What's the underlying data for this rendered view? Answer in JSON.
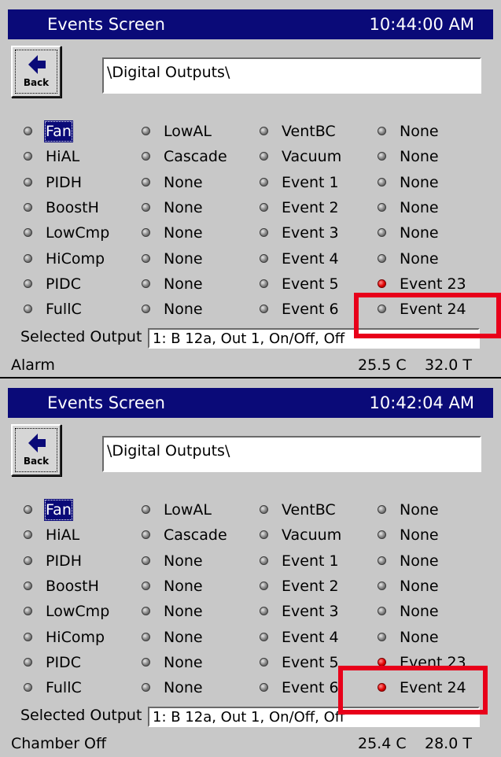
{
  "screens": [
    {
      "title": "Events Screen",
      "clock": "10:44:00 AM",
      "back_label": "Back",
      "path": "\\Digital Outputs\\",
      "columns": [
        [
          {
            "label": "Fan",
            "on": false,
            "selected": true
          },
          {
            "label": "HiAL",
            "on": false
          },
          {
            "label": "PIDH",
            "on": false
          },
          {
            "label": "BoostH",
            "on": false
          },
          {
            "label": "LowCmp",
            "on": false
          },
          {
            "label": "HiComp",
            "on": false
          },
          {
            "label": "PIDC",
            "on": false
          },
          {
            "label": "FullC",
            "on": false
          }
        ],
        [
          {
            "label": "LowAL",
            "on": false
          },
          {
            "label": "Cascade",
            "on": false
          },
          {
            "label": "None",
            "on": false
          },
          {
            "label": "None",
            "on": false
          },
          {
            "label": "None",
            "on": false
          },
          {
            "label": "None",
            "on": false
          },
          {
            "label": "None",
            "on": false
          },
          {
            "label": "None",
            "on": false
          }
        ],
        [
          {
            "label": "VentBC",
            "on": false
          },
          {
            "label": "Vacuum",
            "on": false
          },
          {
            "label": "Event 1",
            "on": false
          },
          {
            "label": "Event 2",
            "on": false
          },
          {
            "label": "Event 3",
            "on": false
          },
          {
            "label": "Event 4",
            "on": false
          },
          {
            "label": "Event 5",
            "on": false
          },
          {
            "label": "Event 6",
            "on": false
          }
        ],
        [
          {
            "label": "None",
            "on": false
          },
          {
            "label": "None",
            "on": false
          },
          {
            "label": "None",
            "on": false
          },
          {
            "label": "None",
            "on": false
          },
          {
            "label": "None",
            "on": false
          },
          {
            "label": "None",
            "on": false
          },
          {
            "label": "Event 23",
            "on": true
          },
          {
            "label": "Event 24",
            "on": false
          }
        ]
      ],
      "selected_output_label": "Selected Output",
      "selected_output_value": "1: B 12a, Out 1, On/Off, Off",
      "status": "Alarm",
      "temp_actual": "25.5 C",
      "temp_target": "32.0 T"
    },
    {
      "title": "Events Screen",
      "clock": "10:42:04 AM",
      "back_label": "Back",
      "path": "\\Digital Outputs\\",
      "columns": [
        [
          {
            "label": "Fan",
            "on": false,
            "selected": true
          },
          {
            "label": "HiAL",
            "on": false
          },
          {
            "label": "PIDH",
            "on": false
          },
          {
            "label": "BoostH",
            "on": false
          },
          {
            "label": "LowCmp",
            "on": false
          },
          {
            "label": "HiComp",
            "on": false
          },
          {
            "label": "PIDC",
            "on": false
          },
          {
            "label": "FullC",
            "on": false
          }
        ],
        [
          {
            "label": "LowAL",
            "on": false
          },
          {
            "label": "Cascade",
            "on": false
          },
          {
            "label": "None",
            "on": false
          },
          {
            "label": "None",
            "on": false
          },
          {
            "label": "None",
            "on": false
          },
          {
            "label": "None",
            "on": false
          },
          {
            "label": "None",
            "on": false
          },
          {
            "label": "None",
            "on": false
          }
        ],
        [
          {
            "label": "VentBC",
            "on": false
          },
          {
            "label": "Vacuum",
            "on": false
          },
          {
            "label": "Event 1",
            "on": false
          },
          {
            "label": "Event 2",
            "on": false
          },
          {
            "label": "Event 3",
            "on": false
          },
          {
            "label": "Event 4",
            "on": false
          },
          {
            "label": "Event 5",
            "on": false
          },
          {
            "label": "Event 6",
            "on": false
          }
        ],
        [
          {
            "label": "None",
            "on": false
          },
          {
            "label": "None",
            "on": false
          },
          {
            "label": "None",
            "on": false
          },
          {
            "label": "None",
            "on": false
          },
          {
            "label": "None",
            "on": false
          },
          {
            "label": "None",
            "on": false
          },
          {
            "label": "Event 23",
            "on": true
          },
          {
            "label": "Event 24",
            "on": true
          }
        ]
      ],
      "selected_output_label": "Selected Output",
      "selected_output_value": "1: B 12a, Out 1, On/Off, Off",
      "status": "Chamber Off",
      "temp_actual": "25.4 C",
      "temp_target": "28.0 T"
    }
  ],
  "colors": {
    "title_bar": "#0a0a78",
    "panel": "#c8c8c8",
    "led_off": "#7a7a7a",
    "led_on": "#e00000",
    "annotation": "#e8001a"
  },
  "annotation_target": "Event 24"
}
